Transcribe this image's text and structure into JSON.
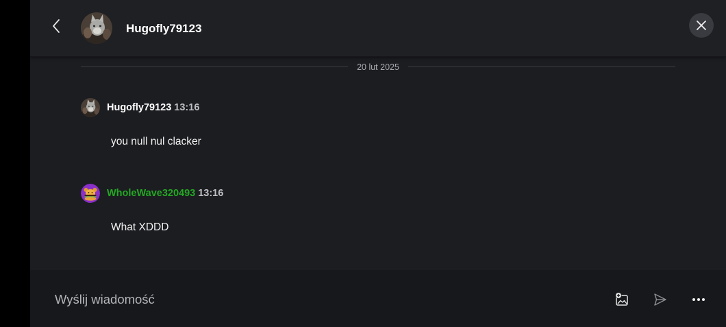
{
  "header": {
    "title": "Hugofly79123"
  },
  "conversation": {
    "date_label": "20 lut 2025",
    "messages": [
      {
        "author": "Hugofly79123",
        "author_color": "#ffffff",
        "time": "13:16",
        "text": "you null nul clacker"
      },
      {
        "author": "WholeWave320493",
        "author_color": "#23a823",
        "time": "13:16",
        "text": "What XDDD"
      }
    ]
  },
  "composer": {
    "placeholder": "Wyślij wiadomość"
  },
  "colors": {
    "panel_background": "#1c1d21",
    "composer_background": "#17181b",
    "accent_green": "#23a823"
  },
  "icons": {
    "back": "chevron-left-icon",
    "close": "close-icon",
    "attach_image": "image-add-icon",
    "send": "send-icon",
    "more": "more-horizontal-icon"
  }
}
